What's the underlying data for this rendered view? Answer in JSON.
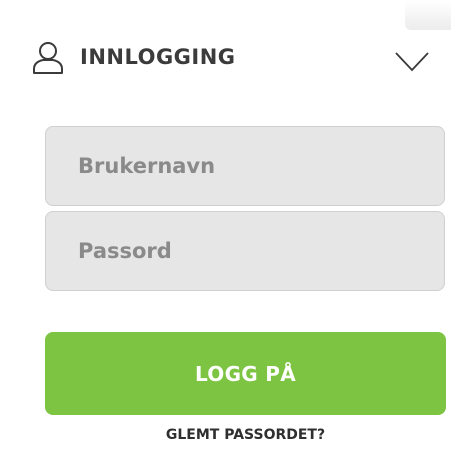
{
  "header": {
    "title": "INNLOGGING",
    "user_icon": "user-icon",
    "toggle_icon": "chevron-down-icon"
  },
  "form": {
    "username_placeholder": "Brukernavn",
    "password_placeholder": "Passord",
    "login_label": "LOGG PÅ",
    "forgot_label": "GLEMT PASSORDET?"
  },
  "colors": {
    "accent": "#7cc442",
    "field_background": "#e6e6e6",
    "text": "#3b3b3b"
  }
}
